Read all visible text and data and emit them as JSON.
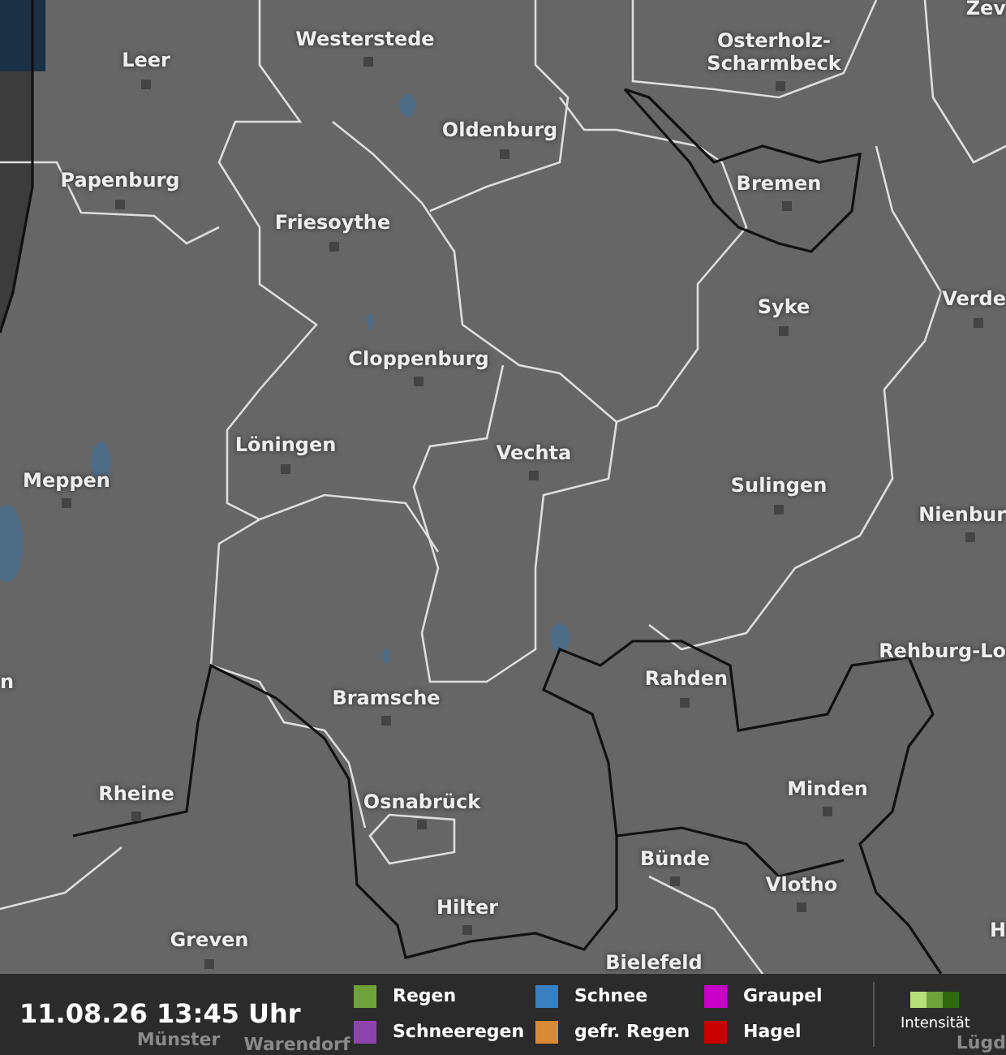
{
  "map": {
    "cities": [
      {
        "name": "Westerstede"
      },
      {
        "name": "Leer"
      },
      {
        "name": "Osterholz-Scharmbeck"
      },
      {
        "name": "Zev"
      },
      {
        "name": "Oldenburg"
      },
      {
        "name": "Papenburg"
      },
      {
        "name": "Bremen"
      },
      {
        "name": "Friesoythe"
      },
      {
        "name": "Syke"
      },
      {
        "name": "Verde"
      },
      {
        "name": "Cloppenburg"
      },
      {
        "name": "Löningen"
      },
      {
        "name": "Vechta"
      },
      {
        "name": "Meppen"
      },
      {
        "name": "Sulingen"
      },
      {
        "name": "Nienbur"
      },
      {
        "name": "Rehburg-Lo"
      },
      {
        "name": "Rahden"
      },
      {
        "name": "n"
      },
      {
        "name": "Bramsche"
      },
      {
        "name": "Rheine"
      },
      {
        "name": "Minden"
      },
      {
        "name": "Osnabrück"
      },
      {
        "name": "Bünde"
      },
      {
        "name": "Vlotho"
      },
      {
        "name": "Hilter"
      },
      {
        "name": "H"
      },
      {
        "name": "Greven"
      },
      {
        "name": "Bielefeld"
      },
      {
        "name": "Münster"
      },
      {
        "name": "Warendorf"
      },
      {
        "name": "Lügd"
      }
    ]
  },
  "timestamp": "11.08.26 13:45 Uhr",
  "legend": {
    "items": [
      {
        "label": "Regen",
        "color": "#6fa33a"
      },
      {
        "label": "Schneeregen",
        "color": "#8e44ad"
      },
      {
        "label": "Schnee",
        "color": "#3a7fbf"
      },
      {
        "label": "gefr. Regen",
        "color": "#d98a37"
      },
      {
        "label": "Graupel",
        "color": "#c800c8"
      },
      {
        "label": "Hagel",
        "color": "#c80000"
      }
    ],
    "intensity": {
      "label": "Intensität",
      "steps": [
        {
          "color": "#b5e07a"
        },
        {
          "color": "#6fa33a"
        },
        {
          "color": "#2f6a10"
        }
      ]
    }
  }
}
